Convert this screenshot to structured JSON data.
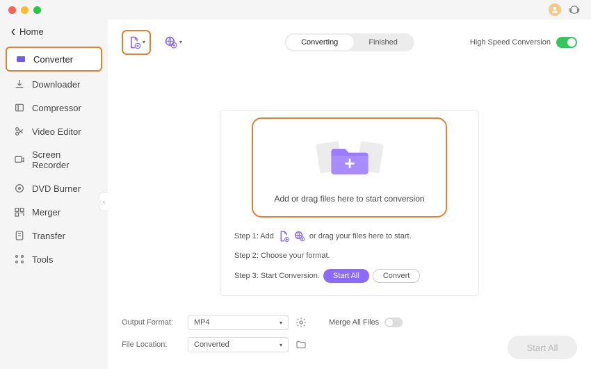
{
  "nav": {
    "back_label": "Home",
    "items": [
      {
        "label": "Converter",
        "icon": "converter-icon"
      },
      {
        "label": "Downloader",
        "icon": "downloader-icon"
      },
      {
        "label": "Compressor",
        "icon": "compressor-icon"
      },
      {
        "label": "Video Editor",
        "icon": "editor-icon"
      },
      {
        "label": "Screen Recorder",
        "icon": "recorder-icon"
      },
      {
        "label": "DVD Burner",
        "icon": "burner-icon"
      },
      {
        "label": "Merger",
        "icon": "merger-icon"
      },
      {
        "label": "Transfer",
        "icon": "transfer-icon"
      },
      {
        "label": "Tools",
        "icon": "tools-icon"
      }
    ]
  },
  "tabs": {
    "converting": "Converting",
    "finished": "Finished"
  },
  "speed": {
    "label": "High Speed Conversion",
    "enabled": true
  },
  "drop": {
    "text": "Add or drag files here to start conversion"
  },
  "steps": {
    "s1_prefix": "Step 1: Add",
    "s1_suffix": "or drag your files here to start.",
    "s2": "Step 2: Choose your format.",
    "s3_prefix": "Step 3: Start Conversion.",
    "start_all_label": "Start  All",
    "convert_label": "Convert"
  },
  "footer": {
    "output_format_label": "Output Format:",
    "output_format_value": "MP4",
    "file_location_label": "File Location:",
    "file_location_value": "Converted",
    "merge_label": "Merge All Files",
    "start_all_button": "Start All"
  },
  "colors": {
    "highlight_orange": "#e97e2e",
    "accent_purple": "#8b6bff",
    "toggle_green": "#34c759"
  }
}
